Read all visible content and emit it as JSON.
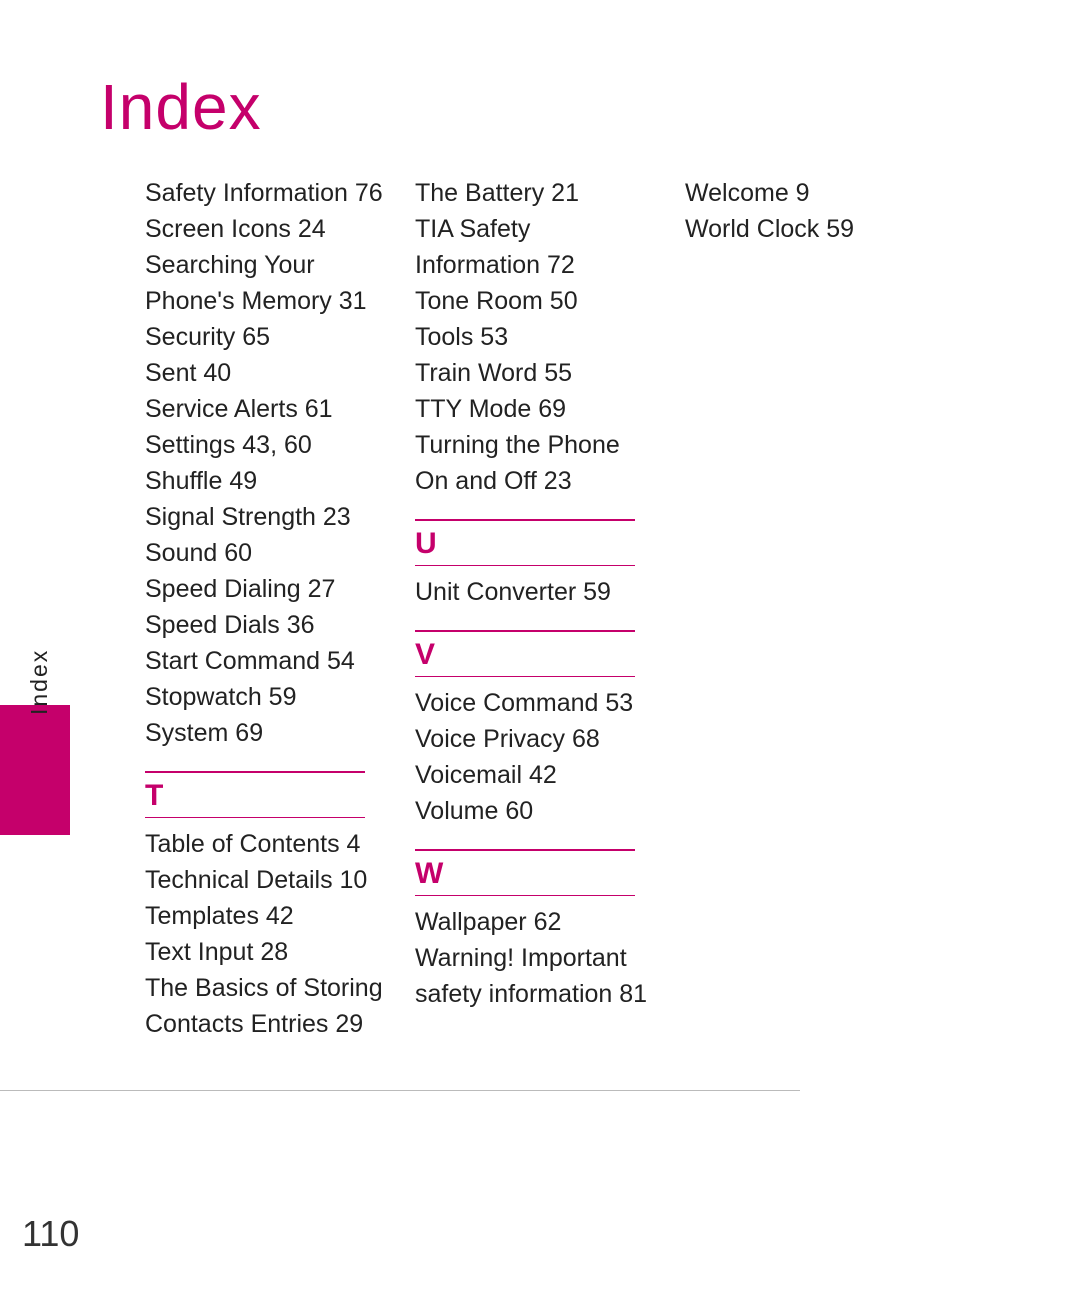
{
  "title": "Index",
  "sideLabel": "Index",
  "pageNumber": "110",
  "col1": [
    {
      "t": "entry",
      "text": "Safety Information 76"
    },
    {
      "t": "entry",
      "text": "Screen Icons 24"
    },
    {
      "t": "entry",
      "text": "Searching Your Phone's Memory 31"
    },
    {
      "t": "entry",
      "text": "Security 65"
    },
    {
      "t": "entry",
      "text": "Sent 40"
    },
    {
      "t": "entry",
      "text": "Service Alerts 61"
    },
    {
      "t": "entry",
      "text": "Settings 43, 60"
    },
    {
      "t": "entry",
      "text": "Shuffle 49"
    },
    {
      "t": "entry",
      "text": "Signal Strength 23"
    },
    {
      "t": "entry",
      "text": "Sound 60"
    },
    {
      "t": "entry",
      "text": "Speed Dialing 27"
    },
    {
      "t": "entry",
      "text": "Speed Dials 36"
    },
    {
      "t": "entry",
      "text": "Start Command 54"
    },
    {
      "t": "entry",
      "text": "Stopwatch 59"
    },
    {
      "t": "entry",
      "text": "System 69"
    },
    {
      "t": "letter",
      "text": "T"
    },
    {
      "t": "entry",
      "text": "Table of Contents 4"
    },
    {
      "t": "entry",
      "text": "Technical Details 10"
    },
    {
      "t": "entry",
      "text": "Templates 42"
    },
    {
      "t": "entry",
      "text": "Text Input 28"
    },
    {
      "t": "entry",
      "text": "The Basics of Storing Contacts Entries 29"
    }
  ],
  "col2": [
    {
      "t": "entry",
      "text": "The Battery 21"
    },
    {
      "t": "entry",
      "text": "TIA Safety Information 72"
    },
    {
      "t": "entry",
      "text": "Tone Room 50"
    },
    {
      "t": "entry",
      "text": "Tools 53"
    },
    {
      "t": "entry",
      "text": "Train Word 55"
    },
    {
      "t": "entry",
      "text": "TTY Mode 69"
    },
    {
      "t": "entry",
      "text": "Turning the Phone On and Off 23"
    },
    {
      "t": "letter",
      "text": "U"
    },
    {
      "t": "entry",
      "text": "Unit Converter 59"
    },
    {
      "t": "letter",
      "text": "V"
    },
    {
      "t": "entry",
      "text": "Voice Command 53"
    },
    {
      "t": "entry",
      "text": "Voice Privacy 68"
    },
    {
      "t": "entry",
      "text": "Voicemail 42"
    },
    {
      "t": "entry",
      "text": "Volume 60"
    },
    {
      "t": "letter",
      "text": "W"
    },
    {
      "t": "entry",
      "text": "Wallpaper 62"
    },
    {
      "t": "entry",
      "text": "Warning! Important safety information 81"
    }
  ],
  "col3": [
    {
      "t": "entry",
      "text": "Welcome 9"
    },
    {
      "t": "entry",
      "text": "World Clock 59"
    }
  ]
}
